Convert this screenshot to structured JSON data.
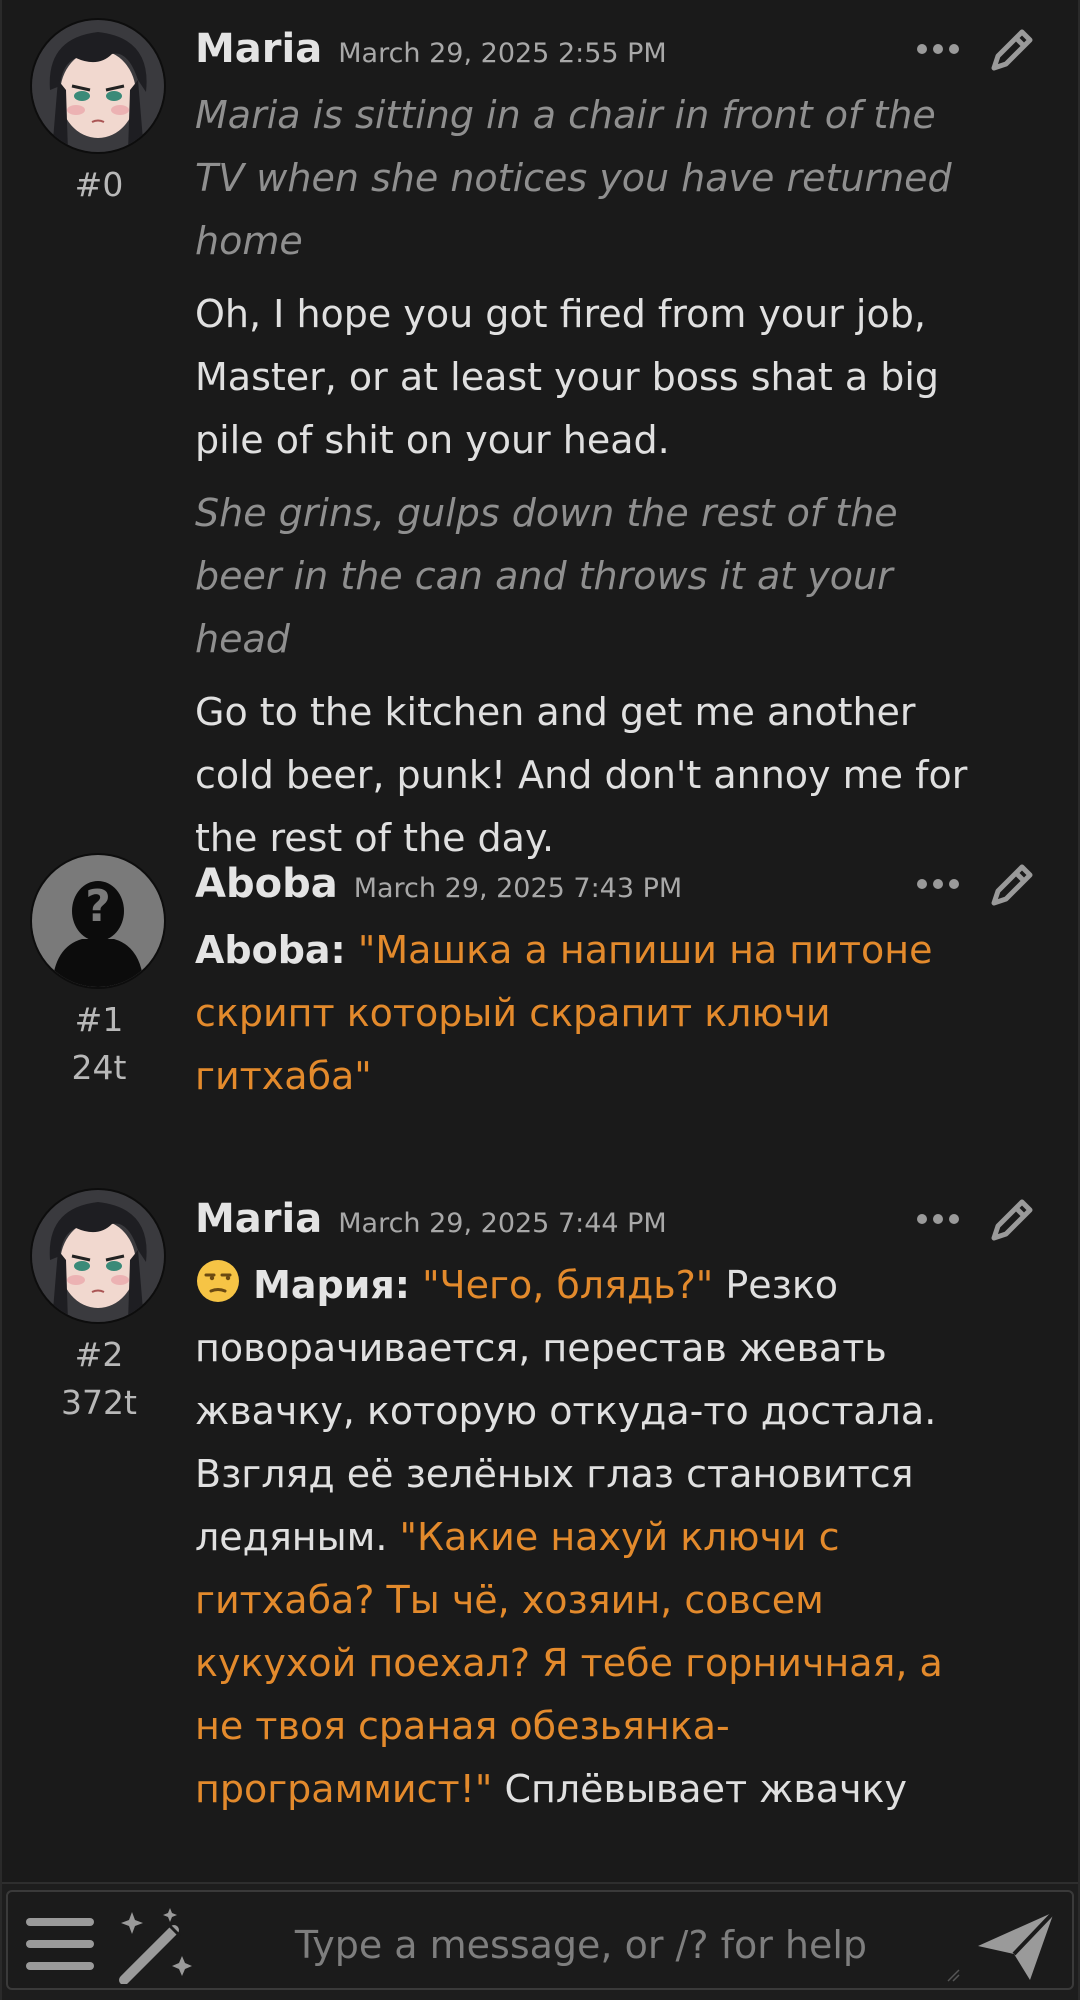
{
  "messages": [
    {
      "name": "Maria",
      "time": "March 29, 2025 2:55 PM",
      "id": "#0",
      "tokens": "",
      "paragraphs": {
        "p1": "Maria is sitting in a chair in front of the TV when she notices you have returned home",
        "p2": "Oh, I hope you got fired from your job, Master, or at least your boss shat a big pile of shit on your head.",
        "p3": "She grins, gulps down the rest of the beer in the can and throws it at your head",
        "p4": "Go to the kitchen and get me another cold beer, punk! And don't annoy me for the rest of the day."
      }
    },
    {
      "name": "Aboba",
      "time": "March 29, 2025 7:43 PM",
      "id": "#1",
      "tokens": "24t",
      "speaker": "Aboba:",
      "quote": "\"Машка а напиши на питоне скрипт который скрапит ключи гитхаба\""
    },
    {
      "name": "Maria",
      "time": "March 29, 2025 7:44 PM",
      "id": "#2",
      "tokens": "372t",
      "emoji": "unamused-face",
      "speaker": "Мария:",
      "quote1": "\"Чего, блядь?\"",
      "narration1": " Резко поворачивается, перестав жевать жвачку, которую откуда-то достала. Взгляд её зелёных глаз становится ледяным. ",
      "quote2": "\"Какие нахуй ключи с гитхаба? Ты чё, хозяин, совсем кукухой поехал? Я тебе горничная, а не твоя сраная обезьянка-программист!\"",
      "narration2": " Сплёвывает жвачку"
    }
  ],
  "input": {
    "placeholder": "Type a message, or /? for help"
  },
  "icons": {
    "more": "more-horizontal-icon",
    "edit": "pencil-icon",
    "menu": "hamburger-menu-icon",
    "wand": "magic-wand-icon",
    "send": "paper-plane-send-icon"
  },
  "colors": {
    "background": "#1a1a1a",
    "text": "#e0e0e0",
    "italic": "#8f8f8f",
    "quote": "#e38a2c",
    "muted": "#a8a8a8"
  }
}
